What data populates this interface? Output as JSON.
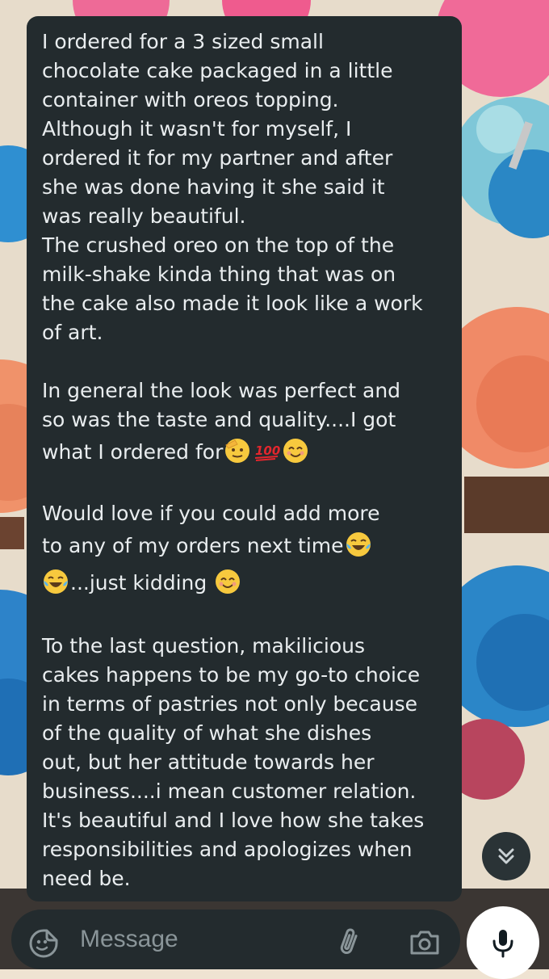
{
  "message": {
    "paragraphs": [
      [
        "I ordered for a 3 sized small",
        "chocolate cake packaged in a little",
        "container with oreos topping.",
        "Although it wasn't for myself, I",
        "ordered it for my partner and after",
        "she was done having it she said it",
        "was really beautiful.",
        "The crushed oreo on the top of the",
        "milk-shake kinda thing that was on",
        "the cake also made it look like a work",
        "of art."
      ],
      [
        "In general the look was perfect and",
        "so was the taste and quality....I got"
      ],
      [
        "what I ordered for"
      ],
      [
        "Would love if you could add more",
        "to any of my orders next time"
      ],
      [
        "...just kidding"
      ],
      [
        "To the last question, makilicious",
        "cakes happens to be my go-to choice",
        "in terms of pastries not only because",
        "of the quality of what she dishes",
        "out, but her attitude towards her",
        "business....i mean customer relation.",
        "It's beautiful and I love how she takes",
        "responsibilities and apologizes when",
        "need be."
      ]
    ]
  },
  "emojis": {
    "salute": "saluting-face-emoji",
    "hundred": "hundred-points-emoji",
    "smile": "smiling-face-emoji",
    "joy": "tears-of-joy-emoji"
  },
  "hundred_text": "100",
  "composer": {
    "placeholder": "Message"
  },
  "colors": {
    "bubble": "#232b2e",
    "text": "#e9edef",
    "accent": "#ffffff"
  }
}
